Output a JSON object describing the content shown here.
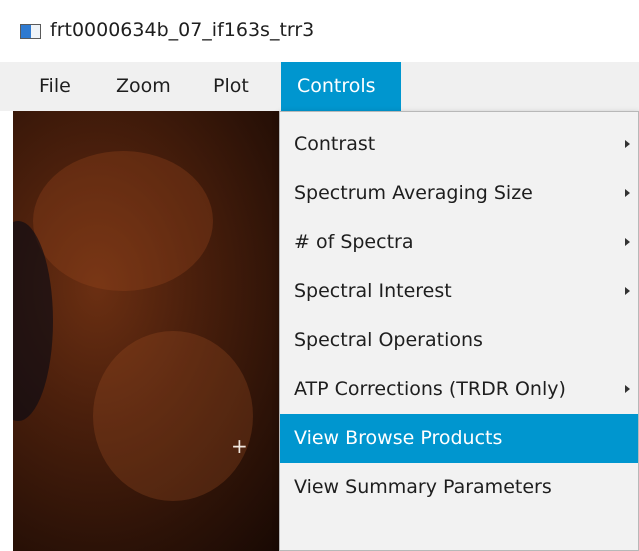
{
  "window": {
    "title": "frt0000634b_07_if163s_trr3",
    "icon": "app-window-icon"
  },
  "menubar": {
    "items": [
      {
        "label": "File"
      },
      {
        "label": "Zoom"
      },
      {
        "label": "Plot"
      },
      {
        "label": "Controls",
        "active": true
      }
    ],
    "accent_color": "#0096cf"
  },
  "controls_menu": {
    "items": [
      {
        "label": "Contrast",
        "submenu": true
      },
      {
        "label": "Spectrum Averaging Size",
        "submenu": true
      },
      {
        "label": "# of Spectra",
        "submenu": true
      },
      {
        "label": "Spectral Interest",
        "submenu": true
      },
      {
        "label": "Spectral Operations",
        "submenu": false
      },
      {
        "label": "ATP Corrections (TRDR Only)",
        "submenu": true
      },
      {
        "label": "View Browse Products",
        "submenu": false,
        "highlighted": true
      },
      {
        "label": "View Summary Parameters",
        "submenu": false
      }
    ]
  },
  "image_view": {
    "cursor_glyph": "+"
  }
}
